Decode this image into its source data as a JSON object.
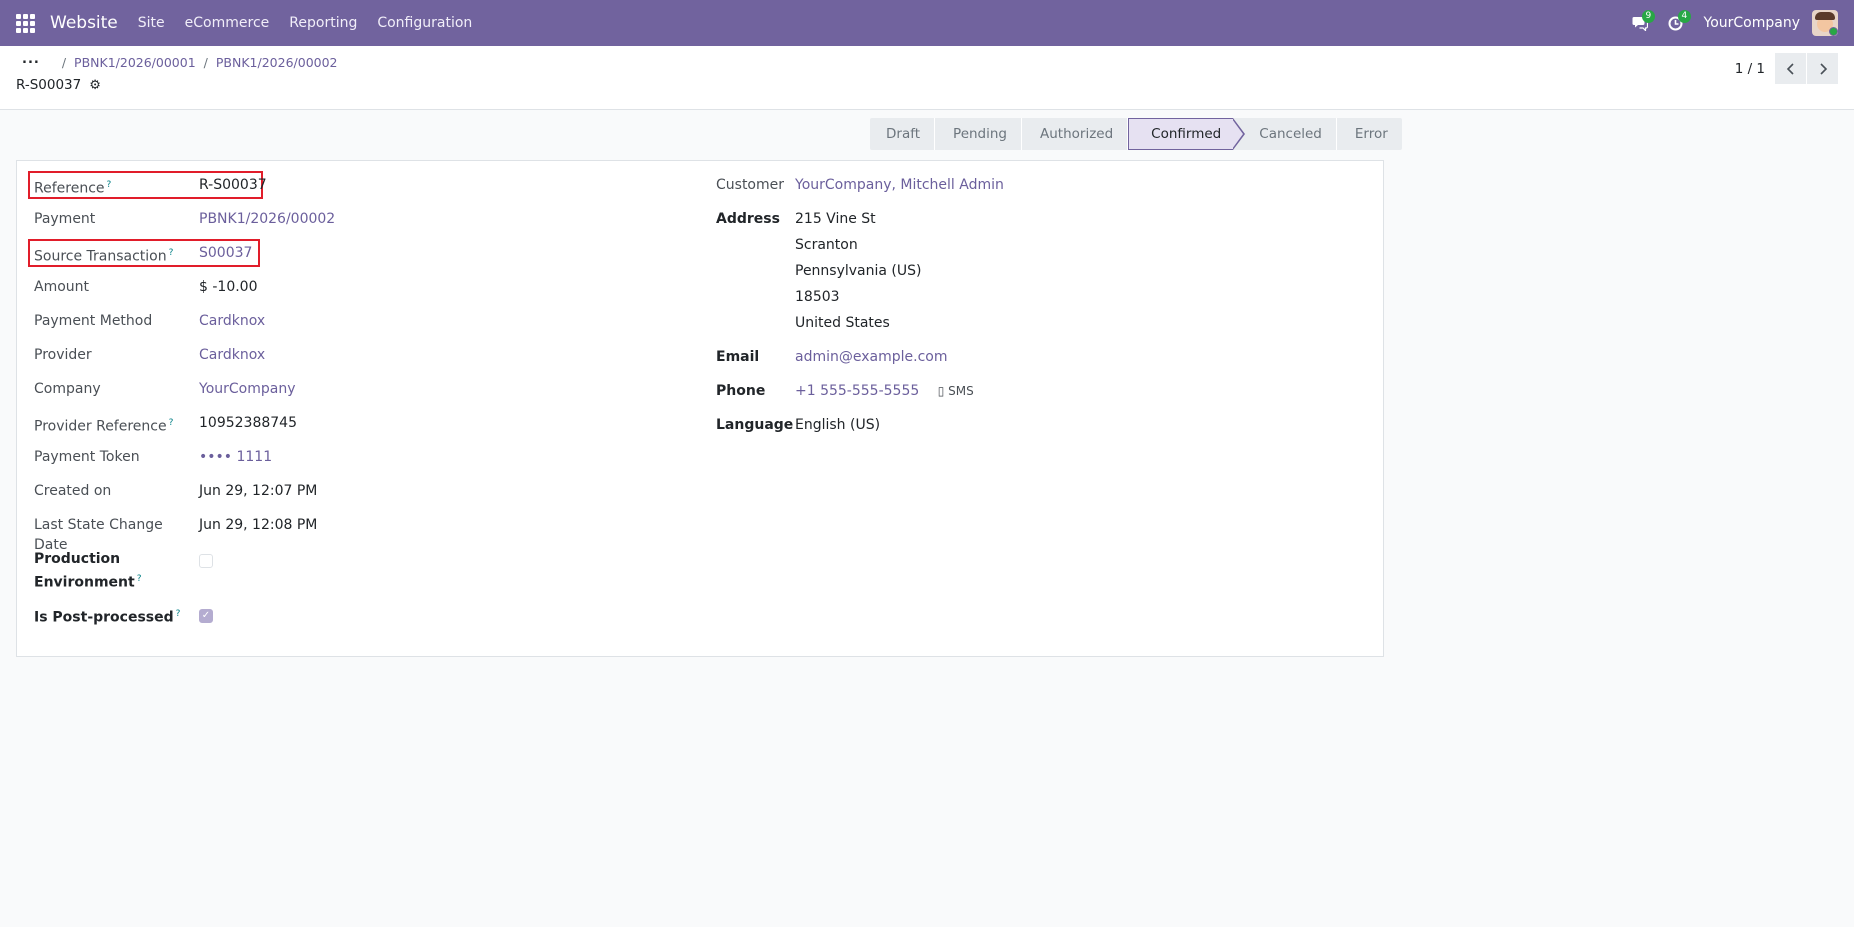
{
  "navbar": {
    "app_name": "Website",
    "menu": [
      "Site",
      "eCommerce",
      "Reporting",
      "Configuration"
    ],
    "messages_badge": "9",
    "activities_badge": "4",
    "company": "YourCompany"
  },
  "breadcrumb": {
    "ellipsis": "...",
    "items": [
      "PBNK1/2026/00001",
      "PBNK1/2026/00002"
    ]
  },
  "record": {
    "title": "R-S00037"
  },
  "pager": {
    "value": "1 / 1"
  },
  "statusbar": {
    "stages": [
      "Draft",
      "Pending",
      "Authorized",
      "Confirmed",
      "Canceled",
      "Error"
    ],
    "active": "Confirmed"
  },
  "left_fields": {
    "reference": {
      "label": "Reference",
      "value": "R-S00037"
    },
    "payment": {
      "label": "Payment",
      "value": "PBNK1/2026/00002"
    },
    "source_transaction": {
      "label": "Source Transaction",
      "value": "S00037"
    },
    "amount": {
      "label": "Amount",
      "value": "$ -10.00"
    },
    "payment_method": {
      "label": "Payment Method",
      "value": "Cardknox"
    },
    "provider": {
      "label": "Provider",
      "value": "Cardknox"
    },
    "company": {
      "label": "Company",
      "value": "YourCompany"
    },
    "provider_reference": {
      "label": "Provider Reference",
      "value": "10952388745"
    },
    "payment_token": {
      "label": "Payment Token",
      "value": "•••• 1111"
    },
    "created_on": {
      "label": "Created on",
      "value": "Jun 29, 12:07 PM"
    },
    "last_state_change": {
      "label": "Last State Change Date",
      "value": "Jun 29, 12:08 PM"
    },
    "production_env": {
      "label_line1": "Production",
      "label_line2": "Environment",
      "checked": false
    },
    "is_post_processed": {
      "label": "Is Post-processed",
      "checked": true
    }
  },
  "right_fields": {
    "customer": {
      "label": "Customer",
      "value": "YourCompany, Mitchell Admin"
    },
    "address": {
      "label": "Address",
      "lines": [
        "215 Vine St",
        "Scranton",
        "Pennsylvania (US)",
        "18503",
        "United States"
      ]
    },
    "email": {
      "label": "Email",
      "value": "admin@example.com"
    },
    "phone": {
      "label": "Phone",
      "value": "+1 555-555-5555",
      "sms": "SMS"
    },
    "language": {
      "label": "Language",
      "value": "English (US)"
    }
  },
  "tooltip_mark": "?",
  "colors": {
    "navbar": "#71639e",
    "link": "#6b5f9c",
    "highlight": "#e11d2a",
    "badge": "#28a745"
  }
}
